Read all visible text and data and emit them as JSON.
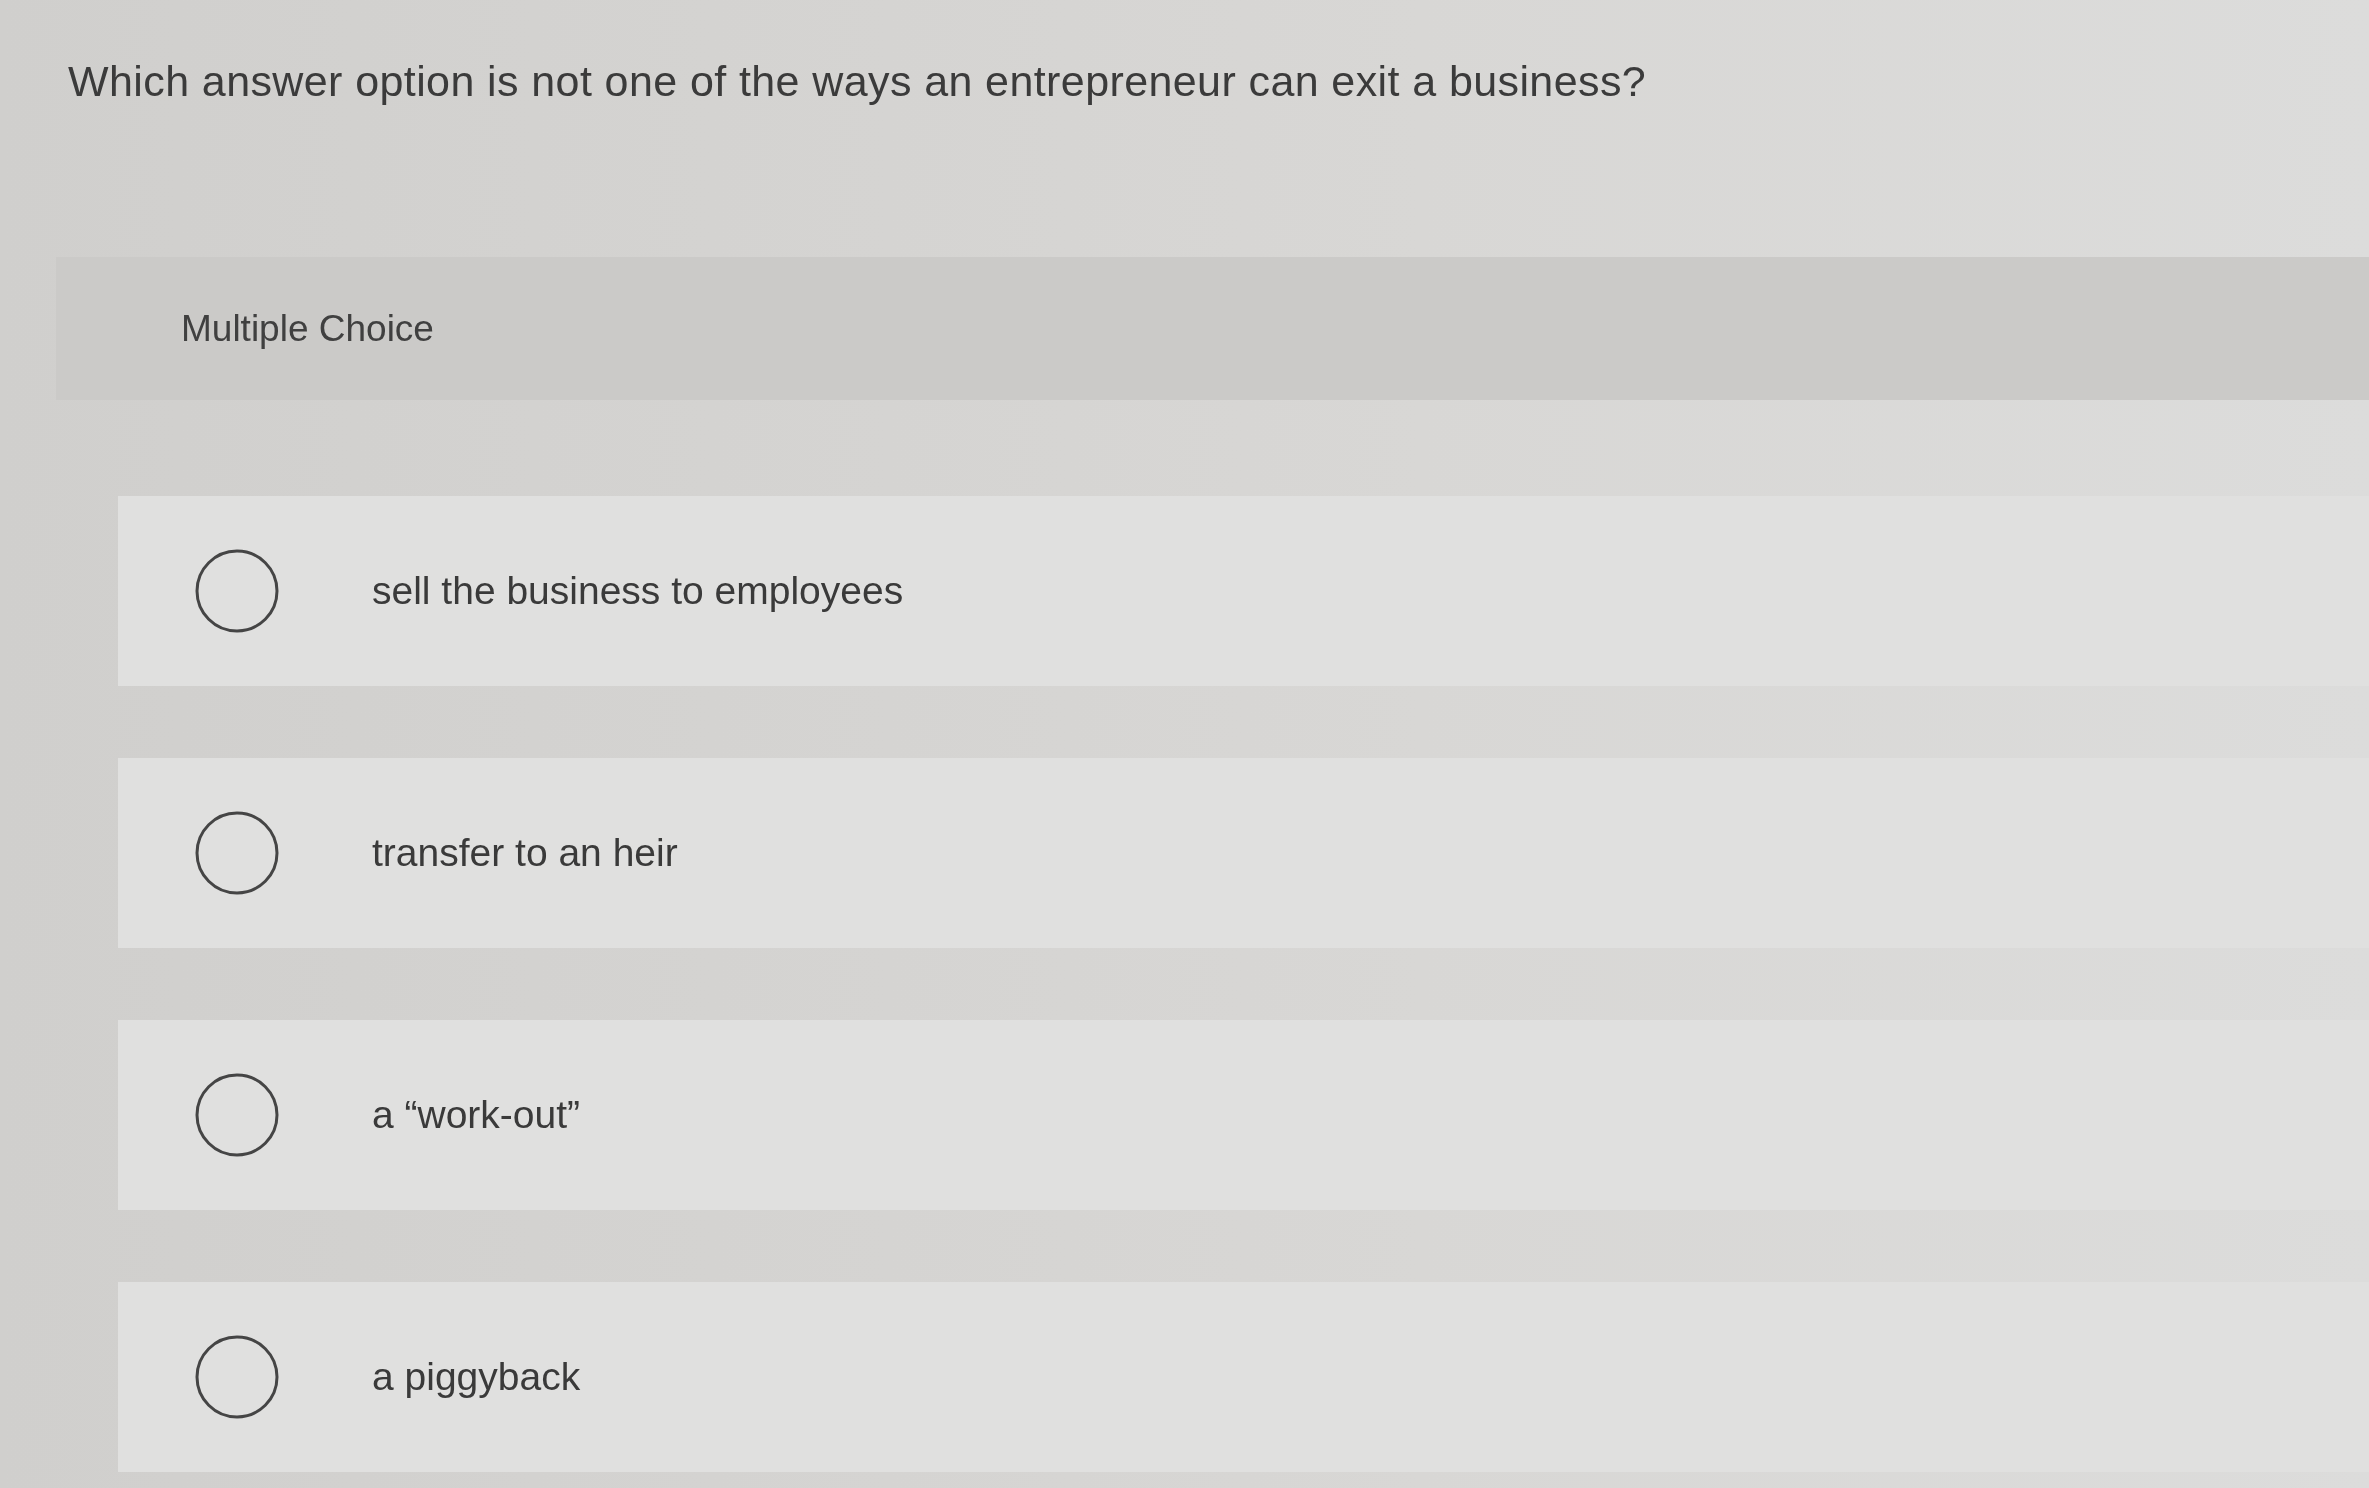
{
  "question": {
    "text": "Which answer option is not one of the ways an entrepreneur can exit a business?"
  },
  "panel": {
    "label": "Multiple Choice"
  },
  "options": [
    {
      "label": "sell the business to employees",
      "selected": false
    },
    {
      "label": "transfer to an heir",
      "selected": false
    },
    {
      "label": "a “work-out”",
      "selected": false
    },
    {
      "label": "a piggyback",
      "selected": false
    }
  ]
}
